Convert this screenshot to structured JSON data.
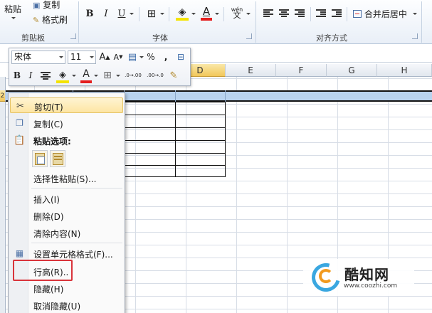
{
  "ribbon": {
    "clipboard": {
      "paste_label": "粘贴",
      "copy_label": "复制",
      "format_painter_label": "格式刷",
      "group_label": "剪贴板"
    },
    "font": {
      "bold": "B",
      "italic": "I",
      "underline": "U",
      "font_color_glyph": "A",
      "phonetic_glyph": "wén",
      "group_label": "字体"
    },
    "alignment": {
      "merge_center_label": "合并后居中",
      "group_label": "对齐方式"
    }
  },
  "grid": {
    "columns": [
      "D",
      "E",
      "F",
      "G",
      "H"
    ],
    "row_number": "2"
  },
  "mini_toolbar": {
    "font_name": "宋体",
    "font_size": "11",
    "grow_font": "A",
    "shrink_font": "A",
    "percent": "%",
    "comma": ",",
    "bold": "B",
    "italic": "I",
    "font_color_glyph": "A",
    "increase_decimal": ".0→.00",
    "decrease_decimal": ".00→.0"
  },
  "context_menu": {
    "items": [
      {
        "label": "剪切(T)"
      },
      {
        "label": "复制(C)"
      },
      {
        "label": "粘贴选项:"
      },
      {
        "label": "选择性粘贴(S)..."
      },
      {
        "label": "插入(I)"
      },
      {
        "label": "删除(D)"
      },
      {
        "label": "清除内容(N)"
      },
      {
        "label": "设置单元格格式(F)..."
      },
      {
        "label": "行高(R).."
      },
      {
        "label": "隐藏(H)"
      },
      {
        "label": "取消隐藏(U)"
      }
    ]
  },
  "watermark": {
    "title": "酷知网",
    "url": "www.coozhi.com"
  },
  "colors": {
    "ribbon_bg": "#e9eff7",
    "selection_blue": "#b9d3ef",
    "hover_gold": "#fde5a3",
    "highlight_red": "#d9343b",
    "logo_blue": "#3aa7e0",
    "logo_orange": "#f29a1f"
  },
  "icons": [
    "scissors-icon",
    "copy-icon",
    "paste-icon",
    "paste-option-icon",
    "format-cells-icon",
    "format-painter-icon",
    "border-icon",
    "fill-color-icon",
    "font-color-icon"
  ]
}
